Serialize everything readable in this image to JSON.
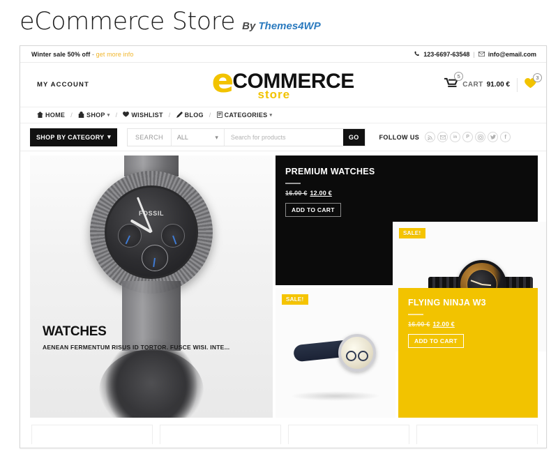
{
  "page": {
    "title": "eCommerce Store",
    "byline_prefix": "By",
    "byline_brand": "Themes4WP"
  },
  "topbar": {
    "promo_bold": "Winter sale 50% off",
    "dash": " - ",
    "promo_link": "get more info",
    "phone_icon": "phone-icon",
    "phone": "123-6697-63548",
    "separator": "|",
    "email_icon": "envelope-icon",
    "email": "info@email.com"
  },
  "masthead": {
    "my_account": "MY ACCOUNT",
    "logo": {
      "e": "e",
      "commerce": "COMMERCE",
      "store": "store"
    },
    "cart": {
      "icon": "shopping-cart-icon",
      "badge": "5",
      "label": "CART",
      "total": "91.00 €"
    },
    "wishlist": {
      "icon": "heart-icon",
      "badge": "3"
    }
  },
  "nav": {
    "separator": "/",
    "items": [
      {
        "label": "HOME",
        "icon": "home-icon",
        "caret": false
      },
      {
        "label": "SHOP",
        "icon": "shopping-bag-icon",
        "caret": true
      },
      {
        "label": "WISHLIST",
        "icon": "heart-icon",
        "caret": false
      },
      {
        "label": "BLOG",
        "icon": "pencil-icon",
        "caret": false
      },
      {
        "label": "CATEGORIES",
        "icon": "document-icon",
        "caret": true
      }
    ],
    "caret_glyph": "▾"
  },
  "searchbar": {
    "shop_by_category": "SHOP BY CATEGORY",
    "shop_caret": "▾",
    "search_label": "SEARCH",
    "category_value": "ALL",
    "category_caret": "▾",
    "search_placeholder": "Search for products",
    "search_value": "",
    "go_label": "GO",
    "follow_label": "FOLLOW US",
    "social": [
      {
        "name": "rss-icon",
        "glyph": "≈"
      },
      {
        "name": "email-icon",
        "glyph": "✉"
      },
      {
        "name": "linkedin-icon",
        "glyph": "in"
      },
      {
        "name": "pinterest-icon",
        "glyph": "℗"
      },
      {
        "name": "instagram-icon",
        "glyph": "▣"
      },
      {
        "name": "twitter-icon",
        "glyph": "🐦"
      },
      {
        "name": "facebook-icon",
        "glyph": "f"
      }
    ]
  },
  "showcase": {
    "hero": {
      "title": "WATCHES",
      "subtitle": "AENEAN FERMENTUM RISUS ID TORTOR. FUSCE WISI. INTE...",
      "image_alt": "fossil-chronograph-watch-photo",
      "watch_brand": "FOSSIL"
    },
    "promo_dark": {
      "title": "PREMIUM WATCHES",
      "price_old": "16.00 €",
      "price_new": "12.00 €",
      "add_to_cart": "ADD TO CART"
    },
    "tile_gold": {
      "sale_badge": "SALE!",
      "image_alt": "black-gold-chronograph-watch-photo"
    },
    "tile_blue": {
      "sale_badge": "SALE!",
      "image_alt": "cream-dial-navy-strap-watch-photo"
    },
    "promo_yellow": {
      "title": "FLYING NINJA W3",
      "price_old": "16.00 €",
      "price_new": "12.00 €",
      "add_to_cart": "ADD TO CART"
    }
  }
}
